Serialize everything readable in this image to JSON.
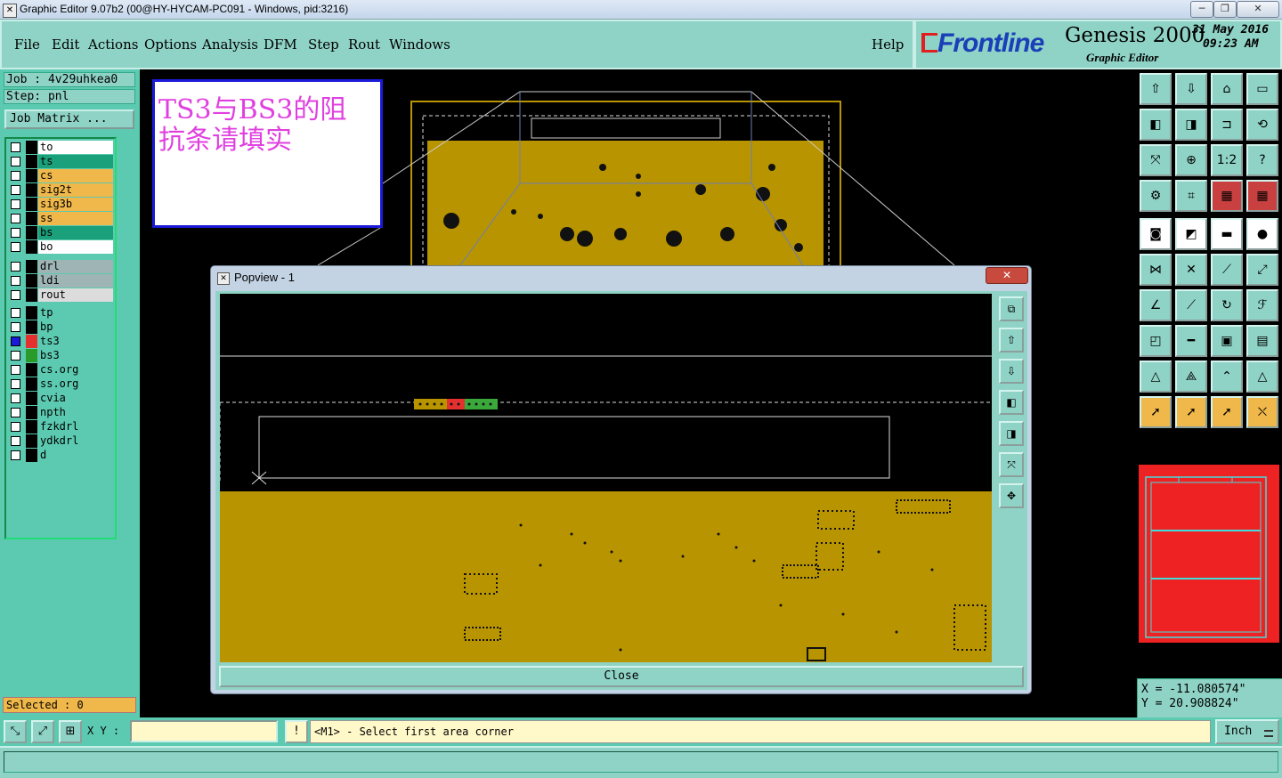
{
  "window": {
    "title": "Graphic Editor 9.07b2 (00@HY-HYCAM-PC091 - Windows, pid:3216)",
    "icon": "app-icon"
  },
  "window_controls": {
    "minimize": "─",
    "maximize": "❐",
    "close": "✕"
  },
  "menu": {
    "items": [
      "File",
      "Edit",
      "Actions",
      "Options",
      "Analysis",
      "DFM",
      "Step",
      "Rout",
      "Windows"
    ],
    "help": "Help"
  },
  "brand": {
    "logo": "Frontline",
    "product": "Genesis 2000",
    "subtitle": "Graphic Editor",
    "date": "31 May 2016",
    "time": "09:23 AM"
  },
  "job": {
    "job_line": "Job : 4v29uhkea0",
    "step_line": "Step: pnl",
    "matrix_button": "Job Matrix ..."
  },
  "layers": [
    {
      "name": "to",
      "color": "#ffffff"
    },
    {
      "name": "ts",
      "color": "#1aa07a"
    },
    {
      "name": "cs",
      "color": "#f0b84a"
    },
    {
      "name": "sig2t",
      "color": "#f0b84a"
    },
    {
      "name": "sig3b",
      "color": "#f0b84a"
    },
    {
      "name": "ss",
      "color": "#f0b84a"
    },
    {
      "name": "bs",
      "color": "#1aa07a"
    },
    {
      "name": "bo",
      "color": "#ffffff"
    },
    {
      "name": "drl",
      "color": "#9fb4b4"
    },
    {
      "name": "ldi",
      "color": "#9fb4b4"
    },
    {
      "name": "rout",
      "color": "#dcdcdc"
    },
    {
      "name": "tp",
      "color": "#5ccab0"
    },
    {
      "name": "bp",
      "color": "#5ccab0"
    },
    {
      "name": "ts3",
      "color": "#5ccab0",
      "swatch": "#e53030",
      "selected": true
    },
    {
      "name": "bs3",
      "color": "#5ccab0",
      "swatch": "#2a9a2a"
    },
    {
      "name": "cs.org",
      "color": "#5ccab0"
    },
    {
      "name": "ss.org",
      "color": "#5ccab0"
    },
    {
      "name": "cvia",
      "color": "#5ccab0"
    },
    {
      "name": "npth",
      "color": "#5ccab0"
    },
    {
      "name": "fzkdrl",
      "color": "#5ccab0"
    },
    {
      "name": "ydkdrl",
      "color": "#5ccab0"
    },
    {
      "name": "d",
      "color": "#5ccab0"
    }
  ],
  "selected_label": "Selected : 0",
  "annotation": {
    "line1": "TS3与BS3的阻",
    "line2": "抗条请填实"
  },
  "popview": {
    "title": "Popview - 1",
    "close_label": "Close",
    "close_x": "✕"
  },
  "right_tools": [
    "zoom-home-icon",
    "zoom-back-icon",
    "home-icon",
    "window-icon",
    "pan-left-icon",
    "pan-right-icon",
    "flip-icon",
    "snap-icon",
    "fit-screen-icon",
    "fit-profile-icon",
    "scale-1to2-icon",
    "help-question-icon",
    "measure-icon",
    "grid-icon",
    "layer-red-icon",
    "layer-red-2-icon",
    "pad-icon",
    "line-icon",
    "ruler-icon",
    "circle-icon",
    "node-icon",
    "cross-icon",
    "segment-icon",
    "arc-icon",
    "angle-icon",
    "slope-icon",
    "rotate-icon",
    "mirror-f-icon",
    "split-icon",
    "minus-icon",
    "frame-icon",
    "shape-icon",
    "triangle-icon",
    "triangle-2-icon",
    "triangle-3-icon",
    "triangle-4-icon",
    "pointer-icon",
    "pointer-select-icon",
    "pointer-3-icon",
    "route-icon"
  ],
  "tool_glyphs": [
    "⇧",
    "⇩",
    "⌂",
    "▭",
    "◧",
    "◨",
    "⊐",
    "⟲",
    "⤧",
    "⊕",
    "1:2",
    "?",
    "⚙",
    "⌗",
    "▦",
    "▦",
    "◙",
    "◩",
    "▬",
    "●",
    "⋈",
    "✕",
    "⟋",
    "⤢",
    "∠",
    "⟋",
    "↻",
    "ℱ",
    "◰",
    "━",
    "▣",
    "▤",
    "△",
    "⟁",
    "⌃",
    "△",
    "➚",
    "➚",
    "➚",
    "⛌"
  ],
  "popview_tools": [
    "zoom-area-icon",
    "zoom-in-icon",
    "zoom-out-icon",
    "pan-left-icon",
    "pan-right-icon",
    "fit-icon",
    "center-icon"
  ],
  "popview_tool_glyphs": [
    "⧉",
    "⇧",
    "⇩",
    "◧",
    "◨",
    "⤧",
    "✥"
  ],
  "coords": {
    "x": "X = -11.080574\"",
    "y": "Y = 20.908824\""
  },
  "status": {
    "xy_label": "X Y :",
    "xy_value": "",
    "prompt": "<M1> - Select first area corner",
    "units": "Inch",
    "alert": "!"
  },
  "colors": {
    "panel": "#5ccab0",
    "copper": "#b89400",
    "annotation_text": "#e040e0"
  }
}
